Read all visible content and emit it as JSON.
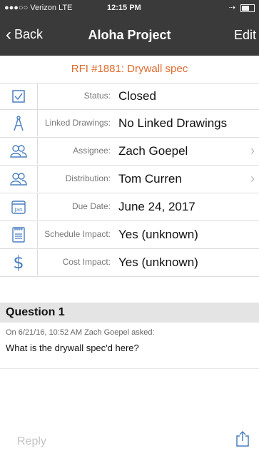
{
  "status_bar": {
    "carrier": "●●●○○ Verizon  LTE",
    "time": "12:15 PM",
    "indicators": "⇢"
  },
  "nav": {
    "back_label": "Back",
    "title": "Aloha Project",
    "edit_label": "Edit"
  },
  "rfi_title": "RFI #1881: Drywall spec",
  "fields": [
    {
      "icon": "checkbox-icon",
      "label": "Status:",
      "value": "Closed"
    },
    {
      "icon": "drawing-compass-icon",
      "label": "Linked Drawings:",
      "value": "No Linked Drawings"
    },
    {
      "icon": "people-icon",
      "label": "Assignee:",
      "value": "Zach Goepel"
    },
    {
      "icon": "people-icon",
      "label": "Distribution:",
      "value": "Tom Curren"
    },
    {
      "icon": "calendar-icon",
      "label": "Due Date:",
      "value": "June 24, 2017",
      "icon_text": "Jan"
    },
    {
      "icon": "schedule-icon",
      "label": "Schedule Impact:",
      "value": "Yes (unknown)"
    },
    {
      "icon": "dollar-icon",
      "label": "Cost Impact:",
      "value": "Yes (unknown)"
    }
  ],
  "question": {
    "header": "Question 1",
    "meta": "On 6/21/16, 10:52 AM Zach Goepel asked:",
    "text": "What is the drywall spec'd here?"
  },
  "reply_placeholder": "Reply",
  "colors": {
    "accent": "#e06a2c",
    "nav_bg": "#3a3a3a",
    "icon_blue": "#4a7fc1"
  }
}
